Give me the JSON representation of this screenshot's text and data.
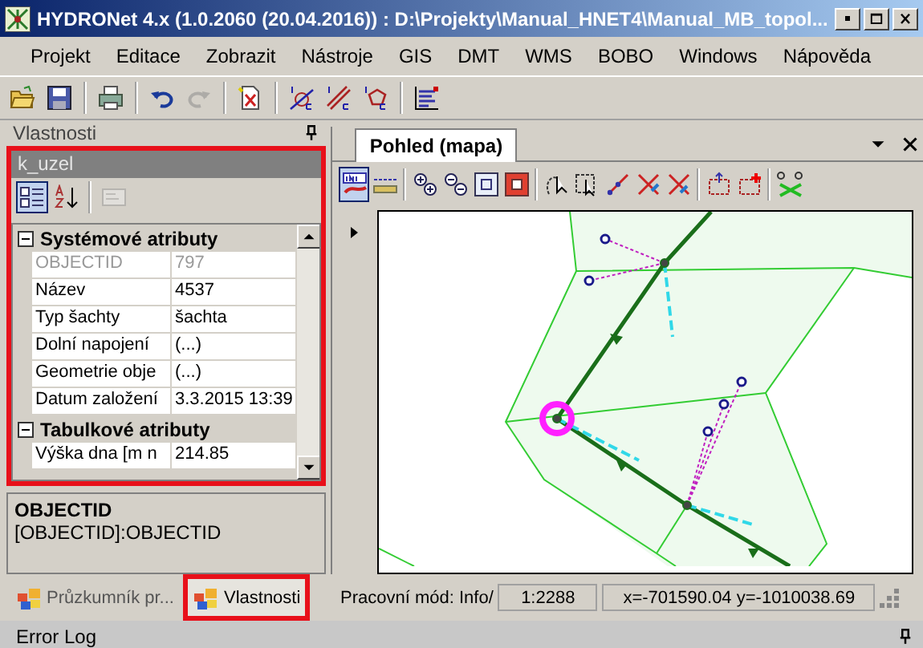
{
  "window": {
    "title": "HYDRONet 4.x (1.0.2060 (20.04.2016)) : D:\\Projekty\\Manual_HNET4\\Manual_MB_topol..."
  },
  "menu": [
    "Projekt",
    "Editace",
    "Zobrazit",
    "Nástroje",
    "GIS",
    "DMT",
    "WMS",
    "BOBO",
    "Windows",
    "Nápověda"
  ],
  "toolbar": [
    {
      "kind": "open",
      "disabled": false
    },
    {
      "kind": "save",
      "disabled": false
    },
    {
      "kind": "separator"
    },
    {
      "kind": "print",
      "disabled": false
    },
    {
      "kind": "separator"
    },
    {
      "kind": "undo",
      "disabled": false
    },
    {
      "kind": "redo",
      "disabled": true
    },
    {
      "kind": "separator"
    },
    {
      "kind": "report",
      "disabled": false
    },
    {
      "kind": "separator"
    },
    {
      "kind": "node-info",
      "disabled": false
    },
    {
      "kind": "line-info",
      "disabled": false
    },
    {
      "kind": "area-info",
      "disabled": false
    },
    {
      "kind": "separator"
    },
    {
      "kind": "profile",
      "disabled": false
    }
  ],
  "properties_panel": {
    "title": "Vlastnosti",
    "highlighted": true,
    "object_name": "k_uzel",
    "toolbar": [
      {
        "kind": "categorized",
        "selected": true,
        "disabled": false
      },
      {
        "kind": "alphabetical",
        "selected": false,
        "disabled": false
      },
      {
        "kind": "pages",
        "selected": false,
        "disabled": true
      }
    ],
    "rows": [
      {
        "kind": "category",
        "label": "Systémové atributy",
        "expanded": true
      },
      {
        "kind": "property",
        "name": "OBJECTID",
        "value": "797",
        "disabled": true
      },
      {
        "kind": "property",
        "name": "Název",
        "value": "4537",
        "disabled": false
      },
      {
        "kind": "property",
        "name": "Typ šachty",
        "value": "šachta",
        "disabled": false
      },
      {
        "kind": "property",
        "name": "Dolní napojení",
        "value": "(...)",
        "disabled": false
      },
      {
        "kind": "property",
        "name": "Geometrie obje",
        "value": "(...)",
        "disabled": false
      },
      {
        "kind": "property",
        "name": "Datum založení",
        "value": "3.3.2015 13:39",
        "disabled": false
      },
      {
        "kind": "category",
        "label": "Tabulkové atributy",
        "expanded": true
      },
      {
        "kind": "property",
        "name": "Výška dna [m n",
        "value": "214.85",
        "disabled": false
      }
    ],
    "description": {
      "title": "OBJECTID",
      "text": "[OBJECTID]:OBJECTID"
    }
  },
  "bottom_tabs": [
    {
      "label": "Průzkumník pr...",
      "selected": false,
      "highlighted": false
    },
    {
      "label": "Vlastnosti",
      "selected": true,
      "highlighted": true
    }
  ],
  "map_view": {
    "tab": "Pohled (mapa)",
    "toolbar": [
      {
        "kind": "info",
        "selected": true
      },
      {
        "kind": "measure",
        "selected": false
      },
      {
        "kind": "separator"
      },
      {
        "kind": "zoom-in",
        "selected": false
      },
      {
        "kind": "zoom-out",
        "selected": false
      },
      {
        "kind": "zoom-extent",
        "selected": false
      },
      {
        "kind": "zoom-full",
        "selected": false
      },
      {
        "kind": "separator"
      },
      {
        "kind": "lasso",
        "selected": false
      },
      {
        "kind": "box-select",
        "selected": false
      },
      {
        "kind": "edge",
        "selected": false
      },
      {
        "kind": "edge-split",
        "selected": false
      },
      {
        "kind": "edge-join",
        "selected": false
      },
      {
        "kind": "separator"
      },
      {
        "kind": "frame-up",
        "selected": false
      },
      {
        "kind": "frame-add",
        "selected": false
      },
      {
        "kind": "separator"
      },
      {
        "kind": "nodes-delete",
        "selected": false
      }
    ]
  },
  "status_bar": {
    "mode": "Pracovní mód: Info/",
    "scale": "1:2288",
    "coordinates": "x=-701590.04 y=-1010038.69"
  },
  "error_log": {
    "title": "Error Log"
  }
}
